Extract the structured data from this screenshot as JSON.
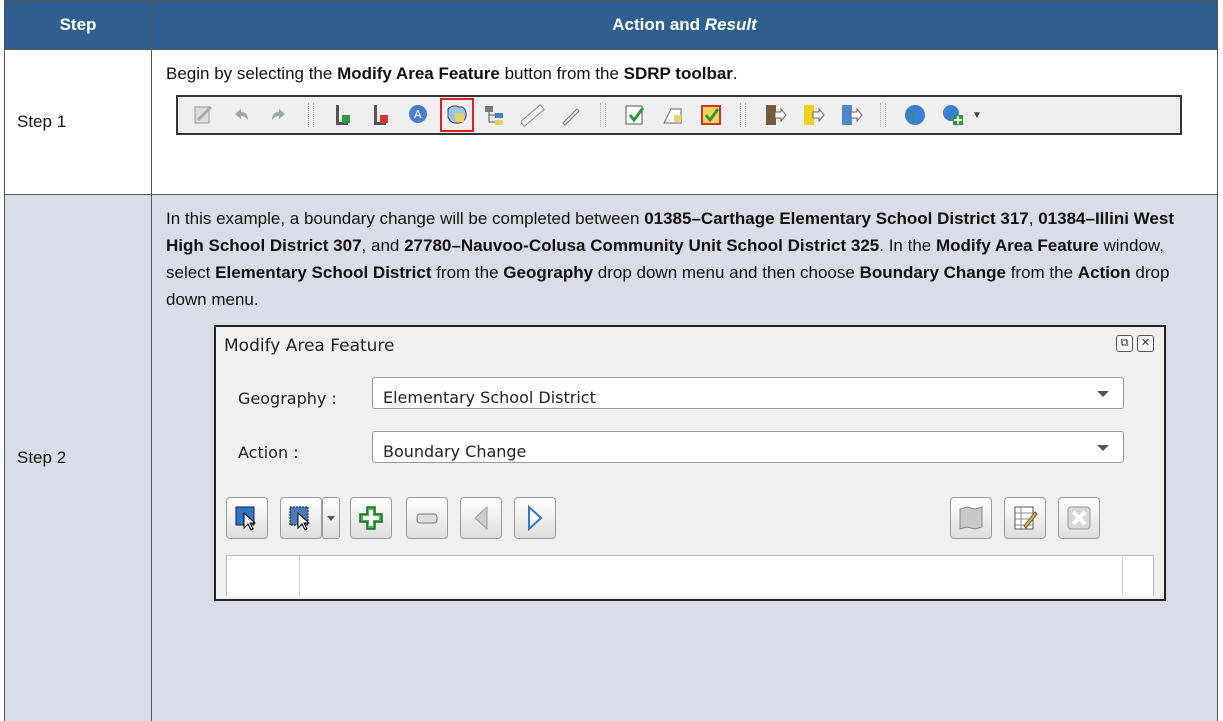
{
  "table": {
    "header": {
      "step": "Step",
      "action_prefix": "Action and ",
      "action_italic": "Result"
    },
    "row1": {
      "step": "Step 1",
      "text": [
        {
          "t": "Begin by selecting the ",
          "b": false
        },
        {
          "t": "Modify Area Feature",
          "b": true
        },
        {
          "t": " button from the ",
          "b": false
        },
        {
          "t": "SDRP toolbar",
          "b": true
        },
        {
          "t": ".",
          "b": false
        }
      ]
    },
    "row2": {
      "step": "Step 2",
      "text": [
        {
          "t": "In this example, a boundary change will be completed between ",
          "b": false
        },
        {
          "t": "01385–Carthage Elementary School District 317",
          "b": true
        },
        {
          "t": ", ",
          "b": false
        },
        {
          "t": "01384–Illini West High School District 307",
          "b": true
        },
        {
          "t": ", and ",
          "b": false
        },
        {
          "t": "27780–Nauvoo-Colusa Community Unit School District 325",
          "b": true
        },
        {
          "t": ". In the ",
          "b": false
        },
        {
          "t": "Modify Area Feature",
          "b": true
        },
        {
          "t": " window, select ",
          "b": false
        },
        {
          "t": "Elementary School District",
          "b": true
        },
        {
          "t": " from the ",
          "b": false
        },
        {
          "t": "Geography",
          "b": true
        },
        {
          "t": " drop down menu and then choose ",
          "b": false
        },
        {
          "t": "Boundary Change",
          "b": true
        },
        {
          "t": " from the ",
          "b": false
        },
        {
          "t": "Action",
          "b": true
        },
        {
          "t": " drop down menu.",
          "b": false
        }
      ]
    }
  },
  "toolbar": {
    "icons": [
      "edit-icon",
      "undo-icon",
      "redo-icon",
      "add-line-icon",
      "delete-line-icon",
      "address-icon",
      "modify-area-feature-icon",
      "attribute-tree-icon",
      "measure-icon",
      "draw-icon",
      "check-icon",
      "copy-shape-icon",
      "validate-icon",
      "import-icon",
      "export-icon",
      "export-blue-icon",
      "globe-icon",
      "add-globe-icon"
    ],
    "highlighted": "modify-area-feature-icon"
  },
  "dialog": {
    "title": "Modify Area Feature",
    "geography_label": "Geography :",
    "geography_value": "Elementary School District",
    "action_label": "Action :",
    "action_value": "Boundary Change"
  },
  "colors": {
    "header_bg": "#2f5f8f",
    "row2_bg": "#d9dde7",
    "highlight": "#e02020"
  }
}
